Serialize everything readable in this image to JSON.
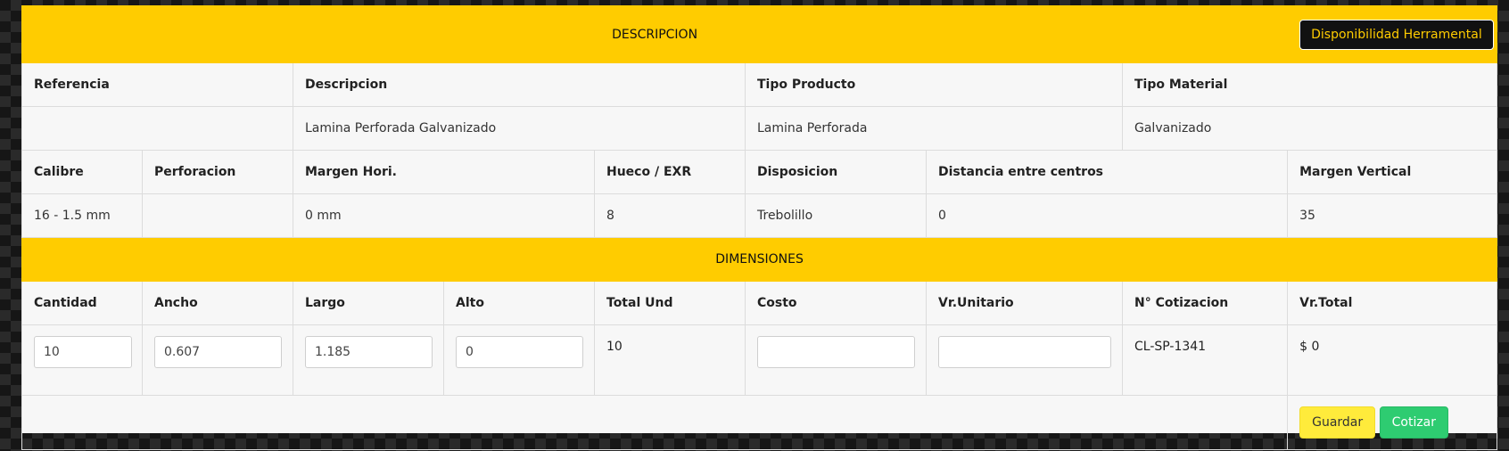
{
  "descripcion": {
    "title": "DESCRIPCION",
    "tool_button": "Disponibilidad Herramental"
  },
  "product": {
    "headers": [
      "Referencia",
      "Descripcion",
      "Tipo Producto",
      "Tipo Material"
    ],
    "values": [
      "",
      "Lamina Perforada Galvanizado",
      "Lamina Perforada",
      "Galvanizado"
    ]
  },
  "specs": {
    "headers": [
      "Calibre",
      "Perforacion",
      "Margen Hori.",
      "Hueco / EXR",
      "Disposicion",
      "Distancia entre centros",
      "Margen Vertical"
    ],
    "values": [
      "16 - 1.5 mm",
      "",
      "0 mm",
      "8",
      "Trebolillo",
      "0",
      "35"
    ]
  },
  "dimensiones": {
    "title": "DIMENSIONES",
    "headers": [
      "Cantidad",
      "Ancho",
      "Largo",
      "Alto",
      "Total Und",
      "Costo",
      "Vr.Unitario",
      "N° Cotizacion",
      "Vr.Total"
    ],
    "cantidad": "10",
    "ancho": "0.607",
    "largo": "1.185",
    "alto": "0",
    "total_und": "10",
    "costo": "",
    "vr_unitario": "",
    "cotizacion": "CL-SP-1341",
    "vr_total": "$ 0"
  },
  "actions": {
    "save_label": "Guardar",
    "quote_label": "Cotizar"
  },
  "colors": {
    "accent": "#ffcc00",
    "panel": "#f7f7f7",
    "save": "#ffeb3b",
    "quote": "#2ecc71"
  }
}
